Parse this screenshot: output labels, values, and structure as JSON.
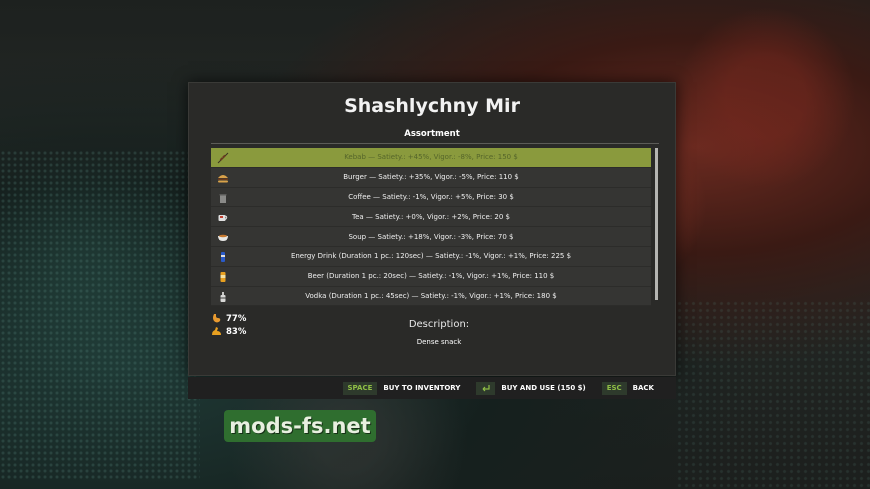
{
  "dialog": {
    "title": "Shashlychny Mir",
    "section_label": "Assortment",
    "items": [
      {
        "icon": "kebab-icon",
        "label": "Kebab — Satiety.: +45%, Vigor.: -8%, Price: 150 $",
        "selected": true
      },
      {
        "icon": "burger-icon",
        "label": "Burger — Satiety.: +35%, Vigor.: -5%, Price: 110 $",
        "selected": false
      },
      {
        "icon": "coffee-icon",
        "label": "Coffee — Satiety.: -1%, Vigor.: +5%, Price: 30 $",
        "selected": false
      },
      {
        "icon": "tea-icon",
        "label": "Tea — Satiety.: +0%, Vigor.: +2%, Price: 20 $",
        "selected": false
      },
      {
        "icon": "soup-icon",
        "label": "Soup — Satiety.: +18%, Vigor.: -3%, Price: 70 $",
        "selected": false
      },
      {
        "icon": "energy-drink-icon",
        "label": "Energy Drink (Duration 1 pc.: 120sec) — Satiety.: -1%, Vigor.: +1%, Price: 225 $",
        "selected": false
      },
      {
        "icon": "beer-icon",
        "label": "Beer (Duration 1 pc.: 20sec) — Satiety.: -1%, Vigor.: +1%, Price: 110 $",
        "selected": false
      },
      {
        "icon": "vodka-icon",
        "label": "Vodka (Duration 1 pc.: 45sec) — Satiety.: -1%, Vigor.: +1%, Price: 180 $",
        "selected": false
      }
    ],
    "stats": {
      "satiety": "77%",
      "vigor": "83%"
    },
    "description_title": "Description:",
    "description_text": "Dense snack"
  },
  "footer": {
    "space_key": "SPACE",
    "buy_inventory_label": "BUY TO INVENTORY",
    "buy_use_label": "BUY AND USE (150 $)",
    "esc_key": "ESC",
    "back_label": "BACK"
  },
  "watermark": "mods-fs.net",
  "colors": {
    "selected_row": "#8a9a3d",
    "key_accent": "#8fbe45",
    "panel": "#2a2a28"
  }
}
